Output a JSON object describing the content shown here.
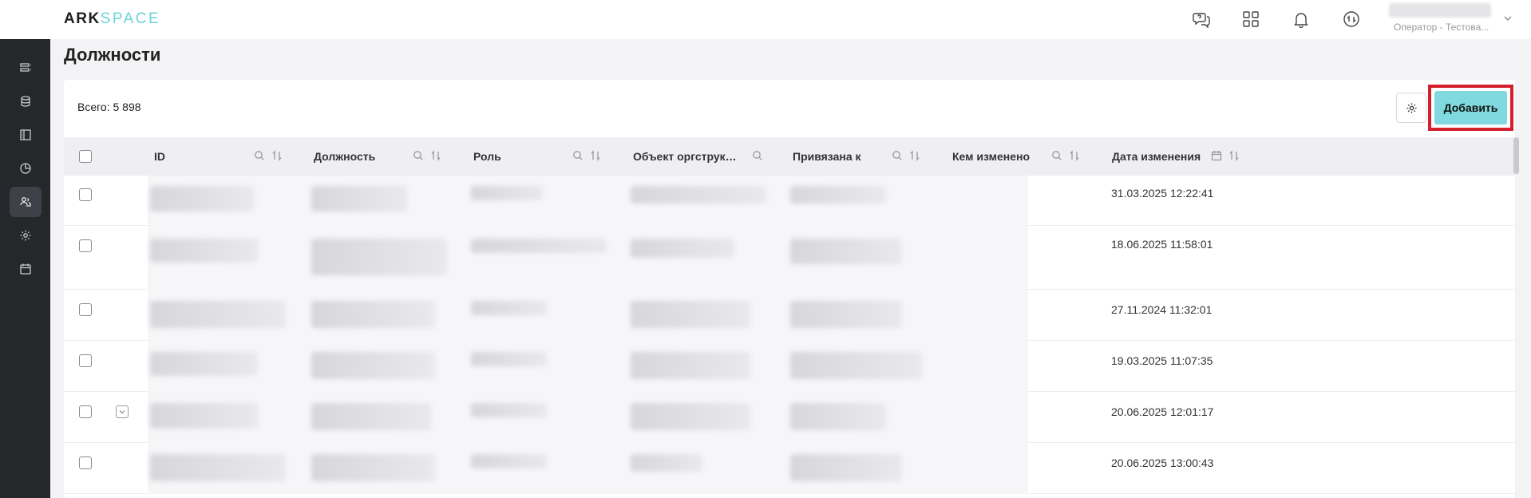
{
  "header": {
    "logo_ark": "ARK",
    "logo_space": "SPACE",
    "user_role": "Оператор - Тестова..."
  },
  "icons": [
    "chat-help-icon",
    "apps-grid-icon",
    "bell-icon",
    "sync-icon",
    "chevron-down-icon"
  ],
  "sidebar": {
    "items": [
      {
        "icon": "list-icon",
        "active": false
      },
      {
        "icon": "database-icon",
        "active": false
      },
      {
        "icon": "panel-icon",
        "active": false
      },
      {
        "icon": "chart-pie-icon",
        "active": false
      },
      {
        "icon": "users-icon",
        "active": true
      },
      {
        "icon": "gear-icon",
        "active": false
      },
      {
        "icon": "calendar-icon",
        "active": false
      }
    ]
  },
  "page": {
    "title": "Должности",
    "total": "Всего: 5 898",
    "add_label": "Добавить"
  },
  "table": {
    "columns": [
      {
        "label": "ID",
        "search": true,
        "sort": true
      },
      {
        "label": "Должность",
        "search": true,
        "sort": true
      },
      {
        "label": "Роль",
        "search": true,
        "sort": true
      },
      {
        "label": "Объект оргструкт...",
        "search": true,
        "sort": false
      },
      {
        "label": "Привязана к",
        "search": true,
        "sort": true
      },
      {
        "label": "Кем изменено",
        "search": true,
        "sort": true
      },
      {
        "label": "Дата изменения",
        "calendar": true,
        "sort": true
      }
    ],
    "rows": [
      {
        "date": "31.03.2025 12:22:41",
        "has_icon": false
      },
      {
        "date": "18.06.2025 11:58:01",
        "has_icon": false
      },
      {
        "date": "27.11.2024 11:32:01",
        "has_icon": false
      },
      {
        "date": "19.03.2025 11:07:35",
        "has_icon": false
      },
      {
        "date": "20.06.2025 12:01:17",
        "has_icon": true
      },
      {
        "date": "20.06.2025 13:00:43",
        "has_icon": false
      }
    ]
  },
  "colors": {
    "accent": "#7fd9de",
    "highlight_border": "#d4202c",
    "sidebar_bg": "#25272b"
  }
}
